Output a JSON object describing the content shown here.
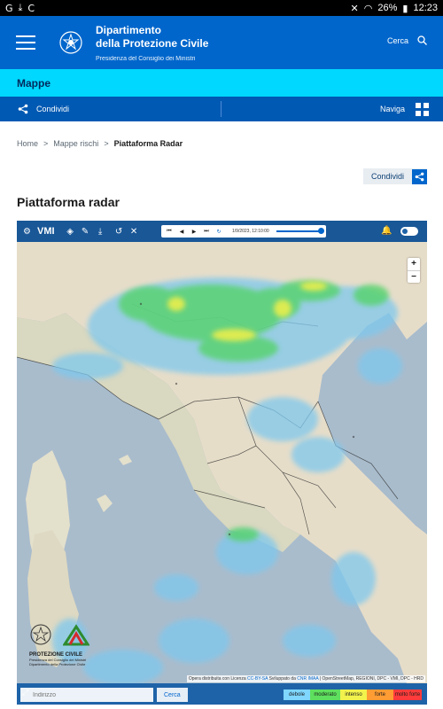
{
  "status": {
    "time": "12:23",
    "battery": "26%"
  },
  "header": {
    "title_line1": "Dipartimento",
    "title_line2": "della Protezione Civile",
    "subtitle": "Presidenza del Consiglio dei Ministri",
    "search_label": "Cerca"
  },
  "mappe_label": "Mappe",
  "sharebar": {
    "share_label": "Condividi",
    "nav_label": "Naviga"
  },
  "breadcrumb": {
    "home": "Home",
    "sep": ">",
    "mappe_rischi": "Mappe rischi",
    "current": "Piattaforma Radar"
  },
  "condividi_label": "Condividi",
  "page_title": "Piattaforma radar",
  "radar": {
    "brand": "VMI",
    "timestamp": "1/9/2023, 12:10:00",
    "address_placeholder": "Indirizzo",
    "search_button": "Cerca",
    "zoom_in": "+",
    "zoom_out": "−",
    "attribution_prefix": "Opera distribuita con Licenza",
    "attribution_license": "CC-BY-SA",
    "attribution_mid": "Sviluppato da",
    "attribution_dev": "CNR IMAA",
    "attribution_suffix": "| OpenStreetMap, REGIONI, DPC - VMI, DPC - HRD",
    "logo_title": "PROTEZIONE CIVILE",
    "logo_sub1": "Presidenza del Consiglio dei Ministri",
    "logo_sub2": "Dipartimento della Protezione Civile",
    "legend": [
      {
        "label": "debole",
        "color": "#7fd7ff"
      },
      {
        "label": "moderato",
        "color": "#5ee05e"
      },
      {
        "label": "intenso",
        "color": "#f2f24d"
      },
      {
        "label": "forte",
        "color": "#ff9c33"
      },
      {
        "label": "molto forte",
        "color": "#ff3b3b"
      }
    ]
  }
}
